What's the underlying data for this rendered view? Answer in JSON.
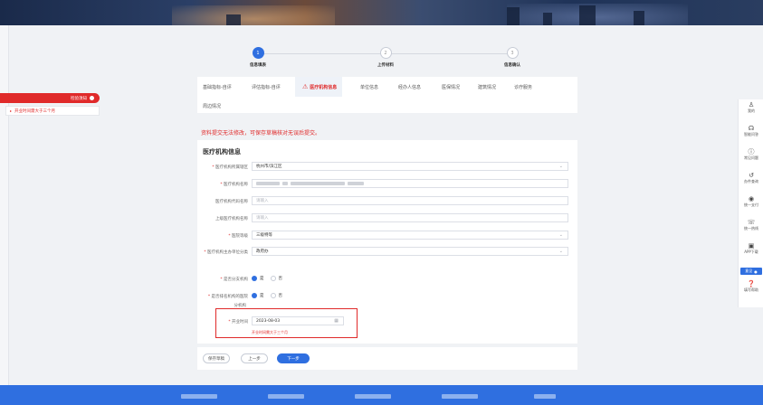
{
  "banner": {
    "subtitle": ""
  },
  "left_tag": {
    "label": "检验须知",
    "tip": "开业时间需大于三个月"
  },
  "steps": [
    {
      "num": "1",
      "label": "信息填表",
      "state": "active"
    },
    {
      "num": "2",
      "label": "上传材料",
      "state": "idle"
    },
    {
      "num": "3",
      "label": "信息确认",
      "state": "idle"
    }
  ],
  "tabs": [
    "基础指标-自评",
    "评估指标-自评",
    "医疗机构信息",
    "单位信息",
    "经办人信息",
    "医保情况",
    "建筑情况",
    "诊疗服务",
    "周边情况"
  ],
  "notice": "资料提交无法修改，可保存草稿核对无误后提交。",
  "form": {
    "title": "医疗机构信息",
    "fields": {
      "region": {
        "label": "医疗机构所属辖区",
        "value": "杭州市/滨江区"
      },
      "name": {
        "label": "医疗机构名称",
        "value": ""
      },
      "code": {
        "label": "医疗机构代码名称",
        "placeholder": "请输入"
      },
      "parent": {
        "label": "上级医疗机构名称",
        "placeholder": "请输入"
      },
      "level": {
        "label": "医院等级",
        "value": "三级特等"
      },
      "subject": {
        "label": "医疗机构主办单位分类",
        "value": "政府办"
      },
      "branch": {
        "label": "是否分支机构",
        "yes": "是",
        "no": "否"
      },
      "headquarter": {
        "label": "是否排名机构的医院",
        "extra": "分机构",
        "yes": "是",
        "no": "否"
      },
      "open_time": {
        "label": "开业时间",
        "value": "2023-08-03",
        "hint": "开业时间需大于三个月"
      }
    }
  },
  "buttons": {
    "save": "保存草稿",
    "prev": "上一步",
    "next": "下一步"
  },
  "right_bar": [
    {
      "icon": "user-icon",
      "label": "我的"
    },
    {
      "icon": "headset-icon",
      "label": "智能问答"
    },
    {
      "icon": "info-icon",
      "label": "常见问题"
    },
    {
      "icon": "history-icon",
      "label": "办件查询"
    },
    {
      "icon": "target-icon",
      "label": "统一支付"
    },
    {
      "icon": "phone-icon",
      "label": "统一热线"
    },
    {
      "icon": "app-icon",
      "label": "APP下载"
    },
    {
      "icon": "feedback-icon",
      "label": "意见"
    },
    {
      "icon": "help-icon",
      "label": "填写帮助"
    }
  ],
  "colors": {
    "accent": "#2f6fe0",
    "danger": "#e02a2a",
    "footer": "#2f6fe0"
  }
}
